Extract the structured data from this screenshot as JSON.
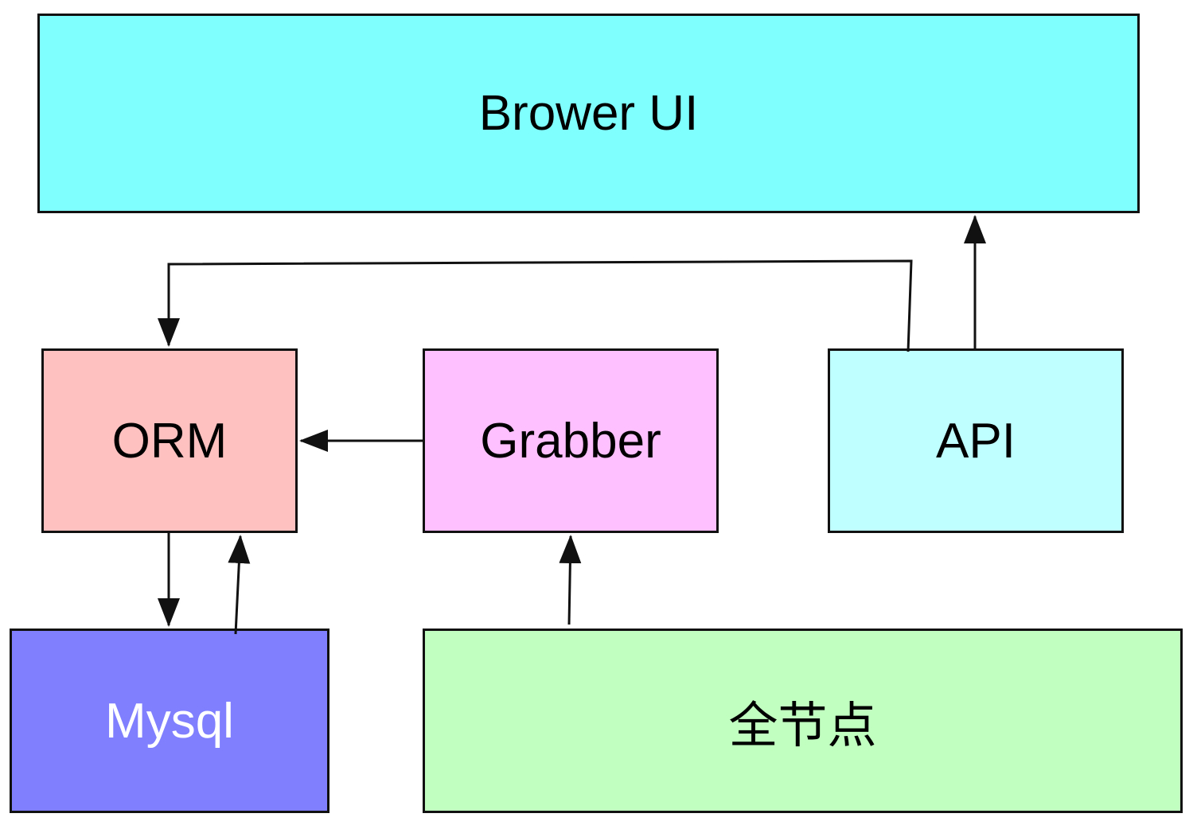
{
  "nodes": {
    "browser_ui": {
      "label": "Brower UI",
      "fill": "#80FFFF",
      "text_color": "#000000"
    },
    "orm": {
      "label": "ORM",
      "fill": "#FFC0C0",
      "text_color": "#000000"
    },
    "grabber": {
      "label": "Grabber",
      "fill": "#FFC0FF",
      "text_color": "#000000"
    },
    "api": {
      "label": "API",
      "fill": "#C0FFFF",
      "text_color": "#000000"
    },
    "mysql": {
      "label": "Mysql",
      "fill": "#8080FF",
      "text_color": "#FFFFFF"
    },
    "full_node": {
      "label": "全节点",
      "fill": "#C0FFC0",
      "text_color": "#000000"
    }
  },
  "edges": [
    {
      "from": "api",
      "to": "browser_ui"
    },
    {
      "from": "api",
      "to": "orm"
    },
    {
      "from": "grabber",
      "to": "orm"
    },
    {
      "from": "orm",
      "to": "mysql"
    },
    {
      "from": "mysql",
      "to": "orm"
    },
    {
      "from": "full_node",
      "to": "grabber"
    }
  ],
  "colors": {
    "stroke": "#111111"
  }
}
